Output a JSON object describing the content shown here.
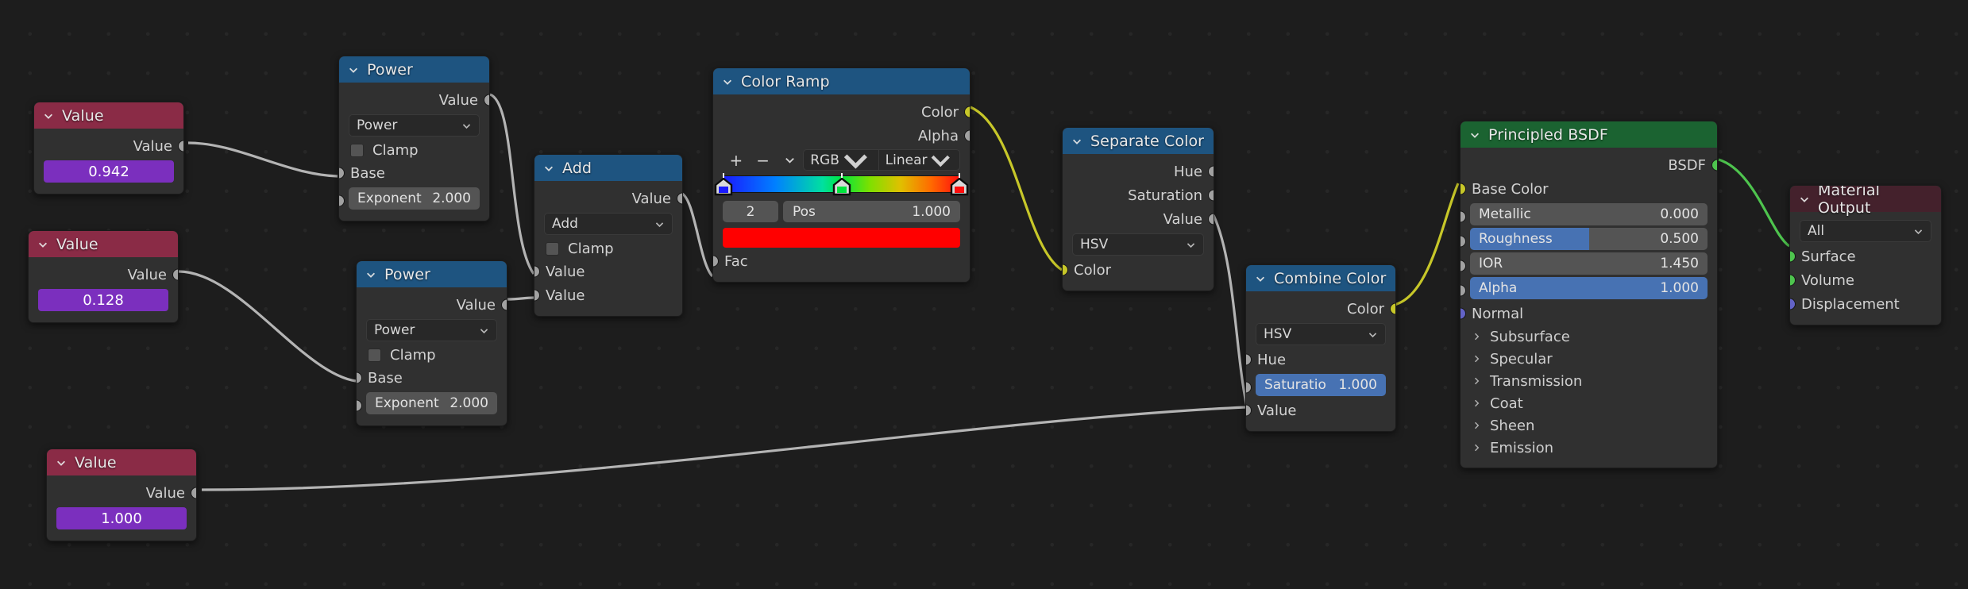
{
  "editor": {
    "name": "blender-shader-node-editor",
    "background": "#1d1d1d"
  },
  "colors": {
    "header_blue": "#1e5480",
    "header_red": "#8a2b46",
    "header_green": "#1b6331",
    "header_darkred": "#44212c",
    "node_body": "#303030",
    "socket_gray": "#a1a1a1",
    "socket_yellow": "#c7c729",
    "socket_green": "#4ec44e",
    "socket_purple": "#6363c7",
    "slider_blue": "#4772b3",
    "value_purple": "#7b2fbe",
    "link_gray": "#b4b4b4",
    "link_yellow": "#c7c729",
    "link_green": "#4ec44e"
  },
  "nodes": {
    "value1": {
      "title": "Value",
      "output_label": "Value",
      "value": "0.942"
    },
    "value2": {
      "title": "Value",
      "output_label": "Value",
      "value": "0.128"
    },
    "value3": {
      "title": "Value",
      "output_label": "Value",
      "value": "1.000"
    },
    "power1": {
      "title": "Power",
      "output_label": "Value",
      "operation": "Power",
      "clamp_label": "Clamp",
      "base_label": "Base",
      "exponent_label": "Exponent",
      "exponent_value": "2.000"
    },
    "power2": {
      "title": "Power",
      "output_label": "Value",
      "operation": "Power",
      "clamp_label": "Clamp",
      "base_label": "Base",
      "exponent_label": "Exponent",
      "exponent_value": "2.000"
    },
    "add": {
      "title": "Add",
      "output_label": "Value",
      "operation": "Add",
      "clamp_label": "Clamp",
      "input1_label": "Value",
      "input2_label": "Value"
    },
    "colorramp": {
      "title": "Color Ramp",
      "output_color": "Color",
      "output_alpha": "Alpha",
      "btn_add": "+",
      "btn_remove": "−",
      "btn_menu": "chevron",
      "color_mode": "RGB",
      "interpolation": "Linear",
      "index": "2",
      "pos_label": "Pos",
      "pos_value": "1.000",
      "swatch_color": "#ff0000",
      "input_fac": "Fac",
      "stops": [
        {
          "pos": 0.0,
          "color": "#1a1aff"
        },
        {
          "pos": 0.5,
          "color": "#00e53d"
        },
        {
          "pos": 1.0,
          "color": "#ff0d0d"
        }
      ]
    },
    "separate_color": {
      "title": "Separate Color",
      "out_hue": "Hue",
      "out_saturation": "Saturation",
      "out_value": "Value",
      "mode": "HSV",
      "in_color": "Color"
    },
    "combine_color": {
      "title": "Combine Color",
      "out_color": "Color",
      "mode": "HSV",
      "in_hue": "Hue",
      "in_saturation_label": "Saturatio",
      "in_saturation_value": "1.000",
      "in_value": "Value"
    },
    "principled": {
      "title": "Principled BSDF",
      "out_bsdf": "BSDF",
      "base_color": "Base Color",
      "metallic_label": "Metallic",
      "metallic_value": "0.000",
      "roughness_label": "Roughness",
      "roughness_value": "0.500",
      "ior_label": "IOR",
      "ior_value": "1.450",
      "alpha_label": "Alpha",
      "alpha_value": "1.000",
      "normal_label": "Normal",
      "panels": [
        "Subsurface",
        "Specular",
        "Transmission",
        "Coat",
        "Sheen",
        "Emission"
      ]
    },
    "material_output": {
      "title": "Material Output",
      "target": "All",
      "in_surface": "Surface",
      "in_volume": "Volume",
      "in_displacement": "Displacement"
    }
  }
}
